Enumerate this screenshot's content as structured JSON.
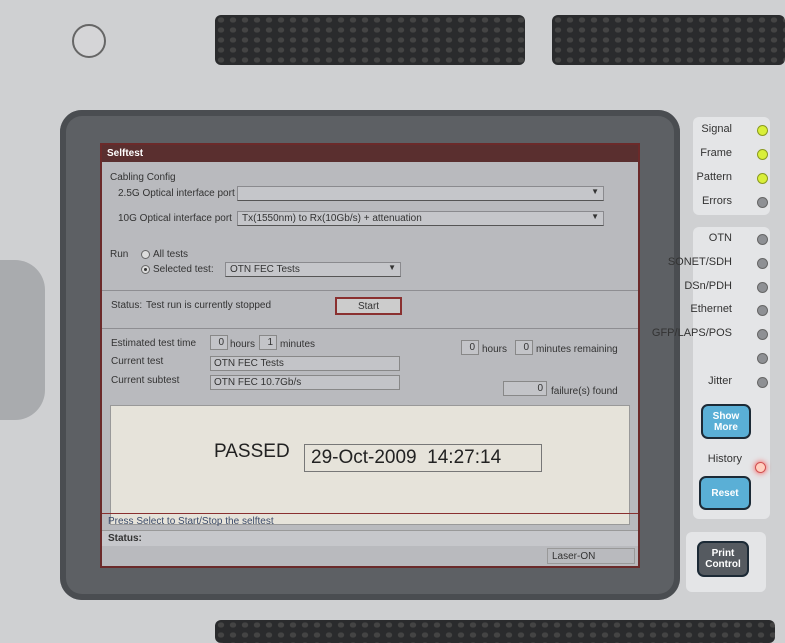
{
  "window": {
    "title": "Selftest"
  },
  "cabling": {
    "heading": "Cabling Config",
    "port_25g_label": "2.5G Optical interface port",
    "port_25g_value": "",
    "port_10g_label": "10G Optical interface port",
    "port_10g_value": "Tx(1550nm) to Rx(10Gb/s) + attenuation"
  },
  "run": {
    "label": "Run",
    "all_tests": "All tests",
    "selected_test": "Selected test:",
    "selected_value": "OTN FEC Tests",
    "selected_option": "selected_test"
  },
  "status": {
    "label": "Status:",
    "text": "Test run is currently stopped",
    "start_button": "Start"
  },
  "timing": {
    "estimated_label": "Estimated test time",
    "est_hours": "0",
    "hours_label": "hours",
    "est_minutes": "1",
    "minutes_label": "minutes",
    "rem_hours": "0",
    "rem_minutes": "0",
    "remaining_label": "minutes remaining"
  },
  "current": {
    "test_label": "Current test",
    "test_value": "OTN FEC Tests",
    "subtest_label": "Current subtest",
    "subtest_value": "OTN FEC 10.7Gb/s",
    "failures": "0",
    "failures_label": "failure(s) found"
  },
  "result": {
    "verdict": "PASSED",
    "timestamp": "29-Oct-2009  14:27:14"
  },
  "footer": {
    "hint": "Press Select to Start/Stop the selftest",
    "status_label": "Status:",
    "laser": "Laser-ON"
  },
  "hardware": {
    "leds_top": [
      {
        "label": "Signal",
        "state": "on"
      },
      {
        "label": "Frame",
        "state": "on"
      },
      {
        "label": "Pattern",
        "state": "on"
      },
      {
        "label": "Errors",
        "state": "off"
      }
    ],
    "leds_mid": [
      {
        "label": "OTN"
      },
      {
        "label": "SONET/SDH"
      },
      {
        "label": "DSn/PDH"
      },
      {
        "label": "Ethernet"
      },
      {
        "label": "GFP/LAPS/POS"
      },
      {
        "label": ""
      },
      {
        "label": "Jitter"
      }
    ],
    "show_more": "Show More",
    "history": "History",
    "reset": "Reset",
    "print_control": "Print Control",
    "colors": {
      "led_on": "#d9ef3a",
      "history_led": "#ff4040",
      "button_blue": "#5aafd6"
    }
  }
}
